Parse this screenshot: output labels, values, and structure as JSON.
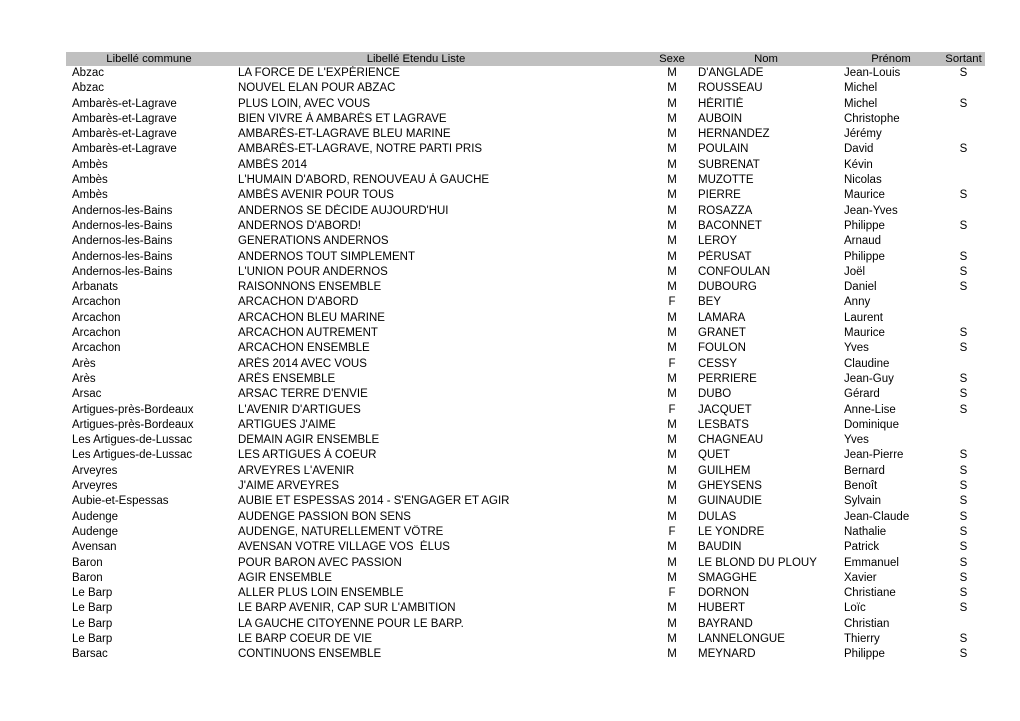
{
  "table": {
    "columns": [
      {
        "key": "commune",
        "label": "Libellé commune"
      },
      {
        "key": "liste",
        "label": "Libellé Etendu Liste"
      },
      {
        "key": "sexe",
        "label": "Sexe"
      },
      {
        "key": "nom",
        "label": "Nom"
      },
      {
        "key": "prenom",
        "label": "Prénom"
      },
      {
        "key": "sortant",
        "label": "Sortant"
      }
    ],
    "header_background": "#c0c0c0",
    "rows": [
      {
        "commune": "Abzac",
        "liste": "LA FORCE DE L'EXPÉRIENCE",
        "sexe": "M",
        "nom": "D'ANGLADE",
        "prenom": "Jean-Louis",
        "sortant": "S"
      },
      {
        "commune": "Abzac",
        "liste": "NOUVEL ELAN POUR ABZAC",
        "sexe": "M",
        "nom": "ROUSSEAU",
        "prenom": "Michel",
        "sortant": ""
      },
      {
        "commune": "Ambarès-et-Lagrave",
        "liste": "PLUS LOIN, AVEC VOUS",
        "sexe": "M",
        "nom": "HÉRITIÉ",
        "prenom": "Michel",
        "sortant": "S"
      },
      {
        "commune": "Ambarès-et-Lagrave",
        "liste": "BIEN VIVRE À AMBARÈS ET LAGRAVE",
        "sexe": "M",
        "nom": "AUBOIN",
        "prenom": "Christophe",
        "sortant": ""
      },
      {
        "commune": "Ambarès-et-Lagrave",
        "liste": "AMBARÈS-ET-LAGRAVE BLEU MARINE",
        "sexe": "M",
        "nom": "HERNANDEZ",
        "prenom": "Jérémy",
        "sortant": ""
      },
      {
        "commune": "Ambarès-et-Lagrave",
        "liste": "AMBARÈS-ET-LAGRAVE, NOTRE PARTI PRIS",
        "sexe": "M",
        "nom": "POULAIN",
        "prenom": "David",
        "sortant": "S"
      },
      {
        "commune": "Ambès",
        "liste": "AMBÈS 2014",
        "sexe": "M",
        "nom": "SUBRENAT",
        "prenom": "Kévin",
        "sortant": ""
      },
      {
        "commune": "Ambès",
        "liste": "L'HUMAIN D'ABORD, RENOUVEAU À GAUCHE",
        "sexe": "M",
        "nom": "MUZOTTE",
        "prenom": "Nicolas",
        "sortant": ""
      },
      {
        "commune": "Ambès",
        "liste": "AMBÈS AVENIR POUR TOUS",
        "sexe": "M",
        "nom": "PIERRE",
        "prenom": "Maurice",
        "sortant": "S"
      },
      {
        "commune": "Andernos-les-Bains",
        "liste": "ANDERNOS SE DÉCIDE AUJOURD'HUI",
        "sexe": "M",
        "nom": "ROSAZZA",
        "prenom": "Jean-Yves",
        "sortant": ""
      },
      {
        "commune": "Andernos-les-Bains",
        "liste": "ANDERNOS D'ABORD!",
        "sexe": "M",
        "nom": "BACONNET",
        "prenom": "Philippe",
        "sortant": "S"
      },
      {
        "commune": "Andernos-les-Bains",
        "liste": "GENERATIONS ANDERNOS",
        "sexe": "M",
        "nom": "LEROY",
        "prenom": "Arnaud",
        "sortant": ""
      },
      {
        "commune": "Andernos-les-Bains",
        "liste": "ANDERNOS TOUT SIMPLEMENT",
        "sexe": "M",
        "nom": "PÉRUSAT",
        "prenom": "Philippe",
        "sortant": "S"
      },
      {
        "commune": "Andernos-les-Bains",
        "liste": "L'UNION POUR ANDERNOS",
        "sexe": "M",
        "nom": "CONFOULAN",
        "prenom": "Joël",
        "sortant": "S"
      },
      {
        "commune": "Arbanats",
        "liste": "RAISONNONS ENSEMBLE",
        "sexe": "M",
        "nom": "DUBOURG",
        "prenom": "Daniel",
        "sortant": "S"
      },
      {
        "commune": "Arcachon",
        "liste": "ARCACHON D'ABORD",
        "sexe": "F",
        "nom": "BEY",
        "prenom": "Anny",
        "sortant": ""
      },
      {
        "commune": "Arcachon",
        "liste": "ARCACHON BLEU MARINE",
        "sexe": "M",
        "nom": "LAMARA",
        "prenom": "Laurent",
        "sortant": ""
      },
      {
        "commune": "Arcachon",
        "liste": "ARCACHON AUTREMENT",
        "sexe": "M",
        "nom": "GRANET",
        "prenom": "Maurice",
        "sortant": "S"
      },
      {
        "commune": "Arcachon",
        "liste": "ARCACHON ENSEMBLE",
        "sexe": "M",
        "nom": "FOULON",
        "prenom": "Yves",
        "sortant": "S"
      },
      {
        "commune": "Arès",
        "liste": "ARÈS 2014 AVEC VOUS",
        "sexe": "F",
        "nom": "CESSY",
        "prenom": "Claudine",
        "sortant": ""
      },
      {
        "commune": "Arès",
        "liste": "ARÈS ENSEMBLE",
        "sexe": "M",
        "nom": "PERRIERE",
        "prenom": "Jean-Guy",
        "sortant": "S"
      },
      {
        "commune": "Arsac",
        "liste": "ARSAC TERRE D'ENVIE",
        "sexe": "M",
        "nom": "DUBO",
        "prenom": "Gérard",
        "sortant": "S"
      },
      {
        "commune": "Artigues-près-Bordeaux",
        "liste": "L'AVENIR D'ARTIGUES",
        "sexe": "F",
        "nom": "JACQUET",
        "prenom": "Anne-Lise",
        "sortant": "S"
      },
      {
        "commune": "Artigues-près-Bordeaux",
        "liste": "ARTIGUES J'AIME",
        "sexe": "M",
        "nom": "LESBATS",
        "prenom": "Dominique",
        "sortant": ""
      },
      {
        "commune": "Les Artigues-de-Lussac",
        "liste": "DEMAIN AGIR ENSEMBLE",
        "sexe": "M",
        "nom": "CHAGNEAU",
        "prenom": "Yves",
        "sortant": ""
      },
      {
        "commune": "Les Artigues-de-Lussac",
        "liste": "LES ARTIGUES À COEUR",
        "sexe": "M",
        "nom": "QUET",
        "prenom": "Jean-Pierre",
        "sortant": "S"
      },
      {
        "commune": "Arveyres",
        "liste": "ARVEYRES L'AVENIR",
        "sexe": "M",
        "nom": "GUILHEM",
        "prenom": "Bernard",
        "sortant": "S"
      },
      {
        "commune": "Arveyres",
        "liste": "J'AIME ARVEYRES",
        "sexe": "M",
        "nom": "GHEYSENS",
        "prenom": "Benoît",
        "sortant": "S"
      },
      {
        "commune": "Aubie-et-Espessas",
        "liste": "AUBIE ET ESPESSAS 2014 - S'ENGAGER ET AGIR",
        "sexe": "M",
        "nom": "GUINAUDIE",
        "prenom": "Sylvain",
        "sortant": "S"
      },
      {
        "commune": "Audenge",
        "liste": "AUDENGE PASSION BON SENS",
        "sexe": "M",
        "nom": "DULAS",
        "prenom": "Jean-Claude",
        "sortant": "S"
      },
      {
        "commune": "Audenge",
        "liste": "AUDENGE, NATURELLEMENT VÔTRE",
        "sexe": "F",
        "nom": "LE YONDRE",
        "prenom": "Nathalie",
        "sortant": "S"
      },
      {
        "commune": "Avensan",
        "liste": "AVENSAN VOTRE VILLAGE VOS  ÉLUS",
        "sexe": "M",
        "nom": "BAUDIN",
        "prenom": "Patrick",
        "sortant": "S"
      },
      {
        "commune": "Baron",
        "liste": "POUR BARON AVEC PASSION",
        "sexe": "M",
        "nom": "LE BLOND DU PLOUY",
        "prenom": "Emmanuel",
        "sortant": "S"
      },
      {
        "commune": "Baron",
        "liste": "AGIR ENSEMBLE",
        "sexe": "M",
        "nom": "SMAGGHE",
        "prenom": "Xavier",
        "sortant": "S"
      },
      {
        "commune": "Le Barp",
        "liste": "ALLER PLUS LOIN ENSEMBLE",
        "sexe": "F",
        "nom": "DORNON",
        "prenom": "Christiane",
        "sortant": "S"
      },
      {
        "commune": "Le Barp",
        "liste": "LE BARP AVENIR, CAP SUR L'AMBITION",
        "sexe": "M",
        "nom": "HUBERT",
        "prenom": "Loïc",
        "sortant": "S"
      },
      {
        "commune": "Le Barp",
        "liste": "LA GAUCHE CITOYENNE POUR LE BARP.",
        "sexe": "M",
        "nom": "BAYRAND",
        "prenom": "Christian",
        "sortant": ""
      },
      {
        "commune": "Le Barp",
        "liste": "LE BARP COEUR DE VIE",
        "sexe": "M",
        "nom": "LANNELONGUE",
        "prenom": "Thierry",
        "sortant": "S"
      },
      {
        "commune": "Barsac",
        "liste": "CONTINUONS ENSEMBLE",
        "sexe": "M",
        "nom": "MEYNARD",
        "prenom": "Philippe",
        "sortant": "S"
      }
    ]
  }
}
